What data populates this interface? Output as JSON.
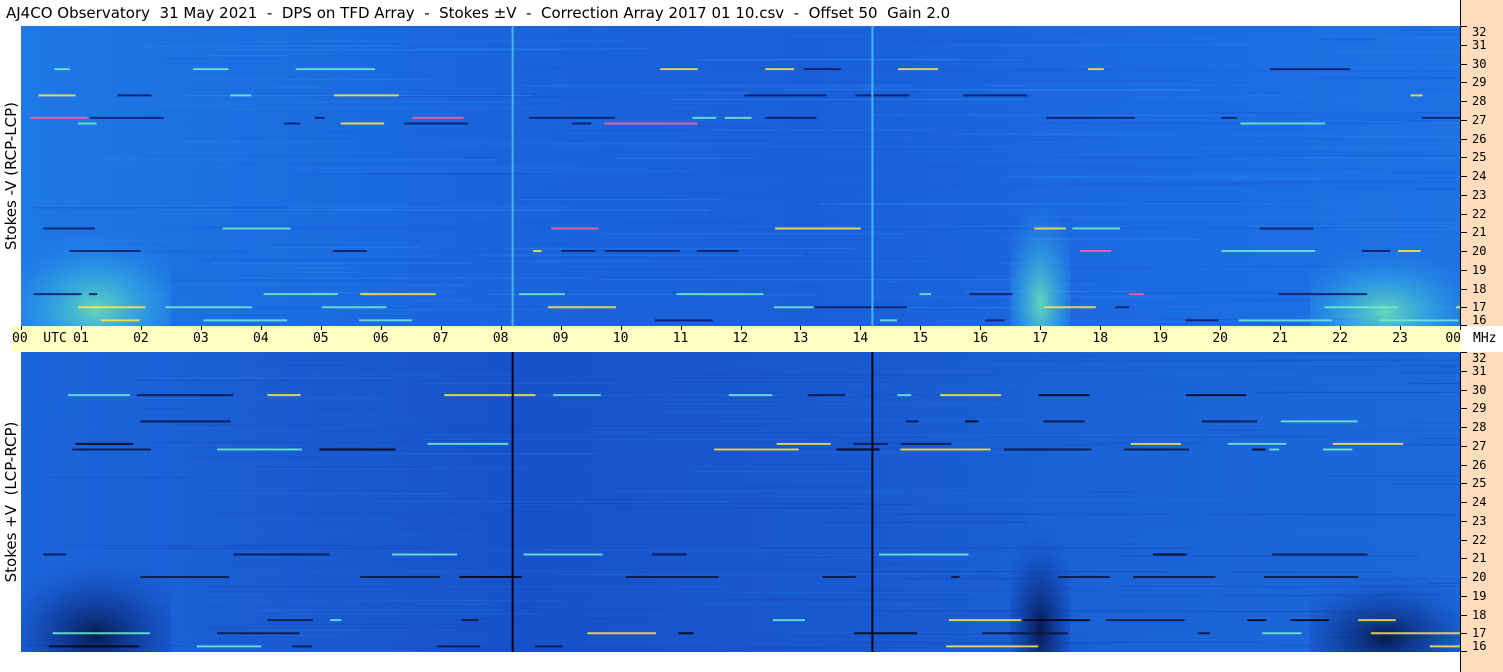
{
  "title": "AJ4CO Observatory  31 May 2021  -  DPS on TFD Array  -  Stokes ±V  -  Correction Array 2017 01 10.csv  -  Offset 50  Gain 2.0",
  "freq_unit": "MHz",
  "colors": {
    "background_blue": "#1f6fe8",
    "time_axis_bg": "#ffffc4",
    "freq_axis_bg": "#ffdcbc"
  },
  "chart_data": {
    "type": "heatmap",
    "title": "AJ4CO Observatory  31 May 2021  -  DPS on TFD Array  -  Stokes ±V  -  Correction Array 2017 01 10.csv  -  Offset 50  Gain 2.0",
    "x_axis": {
      "quantity": "time (UTC hours)",
      "range": [
        0,
        24
      ],
      "tick_labels": [
        "00  UTC",
        "01",
        "02",
        "03",
        "04",
        "05",
        "06",
        "07",
        "08",
        "09",
        "10",
        "11",
        "12",
        "13",
        "14",
        "15",
        "16",
        "17",
        "18",
        "19",
        "20",
        "21",
        "22",
        "23",
        "00"
      ]
    },
    "y_axis": {
      "unit": "MHz",
      "range": [
        16,
        32
      ],
      "tick_labels": [
        "32",
        "31",
        "30",
        "29",
        "28",
        "27",
        "26",
        "25",
        "24",
        "23",
        "22",
        "21",
        "20",
        "19",
        "18",
        "17",
        "16"
      ]
    },
    "panels": [
      {
        "ylabel": "Stokes -V (RCP-LCP)",
        "vertical_lines_utc": [
          8.2,
          14.2
        ],
        "vertical_line_color": "#3fb8e8",
        "interference_bands_mhz": [
          29.7,
          28.3,
          27.1,
          26.8,
          21.2,
          20.0,
          17.7,
          17.0,
          16.3
        ],
        "emission_regions": [
          {
            "utc_start": 0,
            "utc_end": 2.5,
            "mhz_low": 16,
            "mhz_high": 22
          },
          {
            "utc_start": 16.5,
            "utc_end": 17.5,
            "mhz_low": 16,
            "mhz_high": 24
          },
          {
            "utc_start": 21.5,
            "utc_end": 24,
            "mhz_low": 16,
            "mhz_high": 21
          }
        ]
      },
      {
        "ylabel": "Stokes +V  (LCP-RCP)",
        "vertical_lines_utc": [
          8.2,
          14.2
        ],
        "vertical_line_color": "#000814",
        "interference_bands_mhz": [
          29.7,
          28.3,
          27.1,
          26.8,
          21.2,
          20.0,
          17.7,
          17.0,
          16.3
        ],
        "absorption_regions": [
          {
            "utc_start": 0,
            "utc_end": 2.5,
            "mhz_low": 16,
            "mhz_high": 22
          },
          {
            "utc_start": 16.5,
            "utc_end": 17.5,
            "mhz_low": 16,
            "mhz_high": 24
          },
          {
            "utc_start": 21.5,
            "utc_end": 24,
            "mhz_low": 16,
            "mhz_high": 21
          }
        ]
      }
    ]
  }
}
